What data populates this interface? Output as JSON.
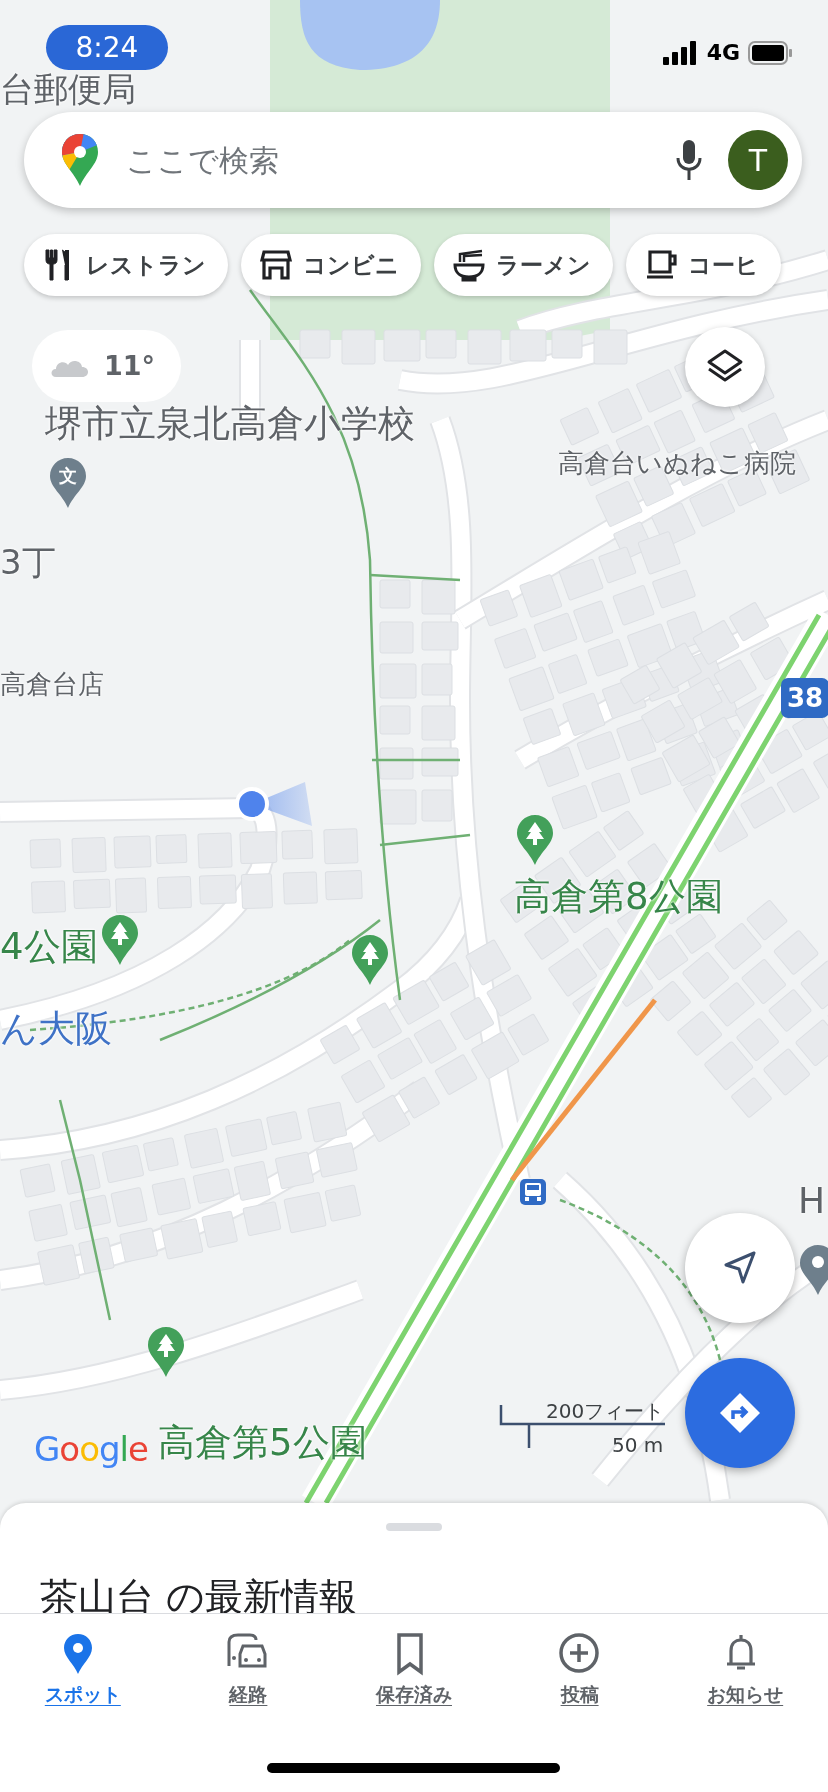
{
  "status_bar": {
    "time": "8:24",
    "network": "4G"
  },
  "search": {
    "placeholder": "ここで検索",
    "avatar_letter": "T"
  },
  "chips": [
    {
      "label": "レストラン",
      "kind": "restaurant"
    },
    {
      "label": "コンビニ",
      "kind": "store"
    },
    {
      "label": "ラーメン",
      "kind": "ramen"
    },
    {
      "label": "コーヒ",
      "kind": "coffee"
    }
  ],
  "weather": {
    "temperature": "11°"
  },
  "map": {
    "labels": [
      {
        "text": "台郵便局",
        "kind": "poi"
      },
      {
        "text": "堺市立泉北高倉小学校",
        "kind": "poi"
      },
      {
        "text": "高倉台いぬねこ病院",
        "kind": "poi"
      },
      {
        "text": "3丁",
        "kind": "poi"
      },
      {
        "text": "高倉台店",
        "kind": "poi"
      },
      {
        "text": "高倉第8公園",
        "kind": "park"
      },
      {
        "text": "4公園",
        "kind": "park"
      },
      {
        "text": "ん大阪",
        "kind": "shop"
      },
      {
        "text": "H",
        "kind": "poi"
      },
      {
        "text": "高倉第5公園",
        "kind": "park"
      }
    ],
    "pins": [
      {
        "kind": "school",
        "glyph": "文"
      },
      {
        "kind": "park"
      },
      {
        "kind": "park"
      },
      {
        "kind": "park"
      },
      {
        "kind": "park"
      },
      {
        "kind": "place"
      }
    ],
    "route_shield": "38",
    "logo": "Google",
    "scale": {
      "feet": "200フィート",
      "meters": "50 m"
    }
  },
  "sheet": {
    "title": "茶山台 の最新情報"
  },
  "nav": [
    {
      "label": "スポット",
      "kind": "explore",
      "selected": true
    },
    {
      "label": "経路",
      "kind": "go",
      "selected": false
    },
    {
      "label": "保存済み",
      "kind": "saved",
      "selected": false
    },
    {
      "label": "投稿",
      "kind": "contribute",
      "selected": false
    },
    {
      "label": "お知らせ",
      "kind": "updates",
      "selected": false
    }
  ]
}
